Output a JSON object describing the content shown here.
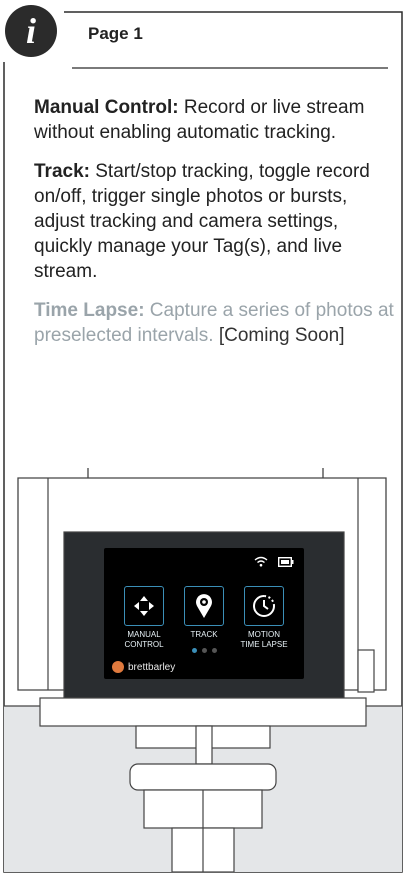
{
  "header": {
    "badge_letter": "i",
    "page_title": "Page 1"
  },
  "paragraphs": [
    {
      "term": "Manual Control:",
      "text": " Record or live stream without enabling automatic tracking."
    },
    {
      "term": "Track:",
      "text": " Start/stop tracking, toggle record on/off, trigger single photos or bursts, adjust tracking and camera settings, quickly manage your Tag(s), and live stream."
    },
    {
      "term": "Time Lapse:",
      "text": " Capture a series of photos at preselected intervals. ",
      "extra": "[Coming Soon]"
    }
  ],
  "device_screen": {
    "status_icons": [
      "wifi-icon",
      "battery-icon"
    ],
    "menu": [
      {
        "line1": "MANUAL",
        "line2": "CONTROL",
        "icon": "manual-control-icon"
      },
      {
        "line1": "TRACK",
        "line2": "",
        "icon": "track-icon"
      },
      {
        "line1": "MOTION",
        "line2": "TIME LAPSE",
        "icon": "time-lapse-icon"
      }
    ],
    "page_dots": {
      "count": 3,
      "active": 1
    },
    "username": "brettbarley"
  },
  "colors": {
    "accent": "#3b8fb8",
    "badge": "#2b2b2b",
    "text": "#222222",
    "dim_text": "#9aa4aa"
  }
}
